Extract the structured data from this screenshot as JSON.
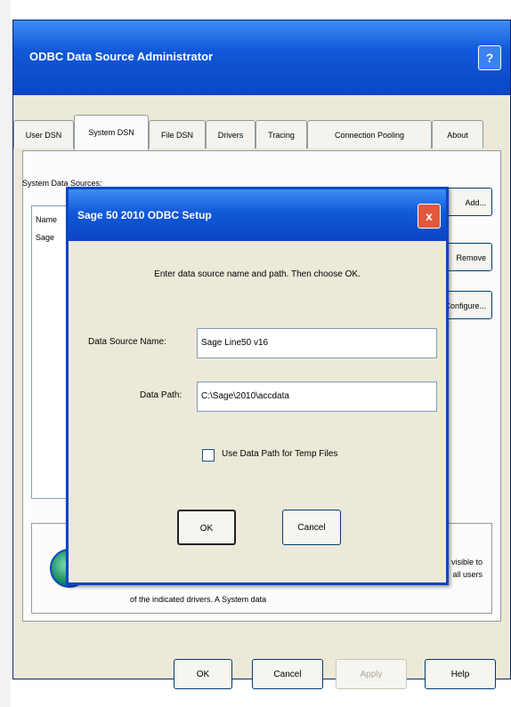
{
  "outer_window": {
    "title": "ODBC Data Source Administrator",
    "help_glyph": "?",
    "tabs": [
      {
        "label": "User DSN"
      },
      {
        "label": "System DSN"
      },
      {
        "label": "File DSN"
      },
      {
        "label": "Drivers"
      },
      {
        "label": "Tracing"
      },
      {
        "label": "Connection Pooling"
      },
      {
        "label": "About"
      }
    ],
    "active_tab": "System DSN",
    "section_label": "System Data Sources:",
    "list_header": "Name",
    "list_row": "Sage",
    "side_buttons": [
      "Add...",
      "Remove",
      "Configure..."
    ],
    "info_line": "of the indicated drivers. A System data",
    "info_right": "visible to\nall users",
    "bottom_buttons": [
      "OK",
      "Cancel",
      "Apply",
      "Help"
    ]
  },
  "dialog": {
    "title": "Sage 50 2010 ODBC Setup",
    "close_glyph": "x",
    "instruction": "Enter data source name and path. Then choose OK.",
    "data_source_name_label": "Data Source Name:",
    "data_source_name_value": "Sage Line50 v16",
    "data_path_label": "Data Path:",
    "data_path_value": "C:\\Sage\\2010\\accdata",
    "checkbox_label": "Use Data Path for Temp Files",
    "checkbox_checked": false,
    "ok_label": "OK",
    "cancel_label": "Cancel"
  },
  "colors": {
    "titlebar": "#0a46c5",
    "window_bg": "#ece9d8",
    "close_button": "#e0593a"
  },
  "icons": {
    "info": "data-sources-icon",
    "help": "help-icon",
    "close": "close-icon"
  }
}
